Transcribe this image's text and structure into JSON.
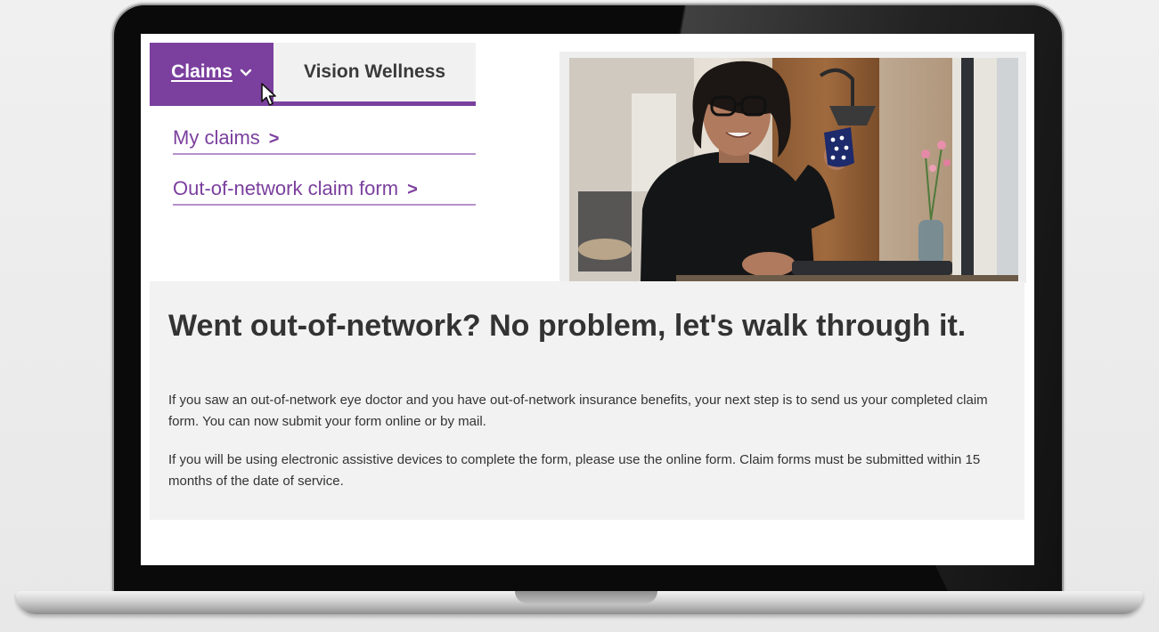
{
  "nav": {
    "claims_tab": "Claims",
    "vision_tab": "Vision Wellness"
  },
  "dropdown": {
    "items": [
      {
        "label": "My claims",
        "arrow": ">"
      },
      {
        "label": "Out-of-network claim form",
        "arrow": ">"
      }
    ]
  },
  "content": {
    "heading": "Went out-of-network? No problem, let's walk through it.",
    "paragraphs": [
      "If you saw an out-of-network eye doctor and you have out-of-network insurance benefits, your next step is to send us your completed claim form. You can now submit your form online or by mail.",
      "If you will be using electronic assistive devices to complete the form, please use the online form. Claim forms must be submitted within 15 months of the date of service."
    ]
  },
  "colors": {
    "brand_purple": "#7b3f9e",
    "link_underline": "#b690c9",
    "text_dark": "#333333",
    "panel_gray": "#f2f2f2"
  },
  "icons": {
    "tab_chevron": "chevron-down-icon",
    "link_arrow": "chevron-right-icon",
    "pointer": "mouse-cursor-icon"
  }
}
